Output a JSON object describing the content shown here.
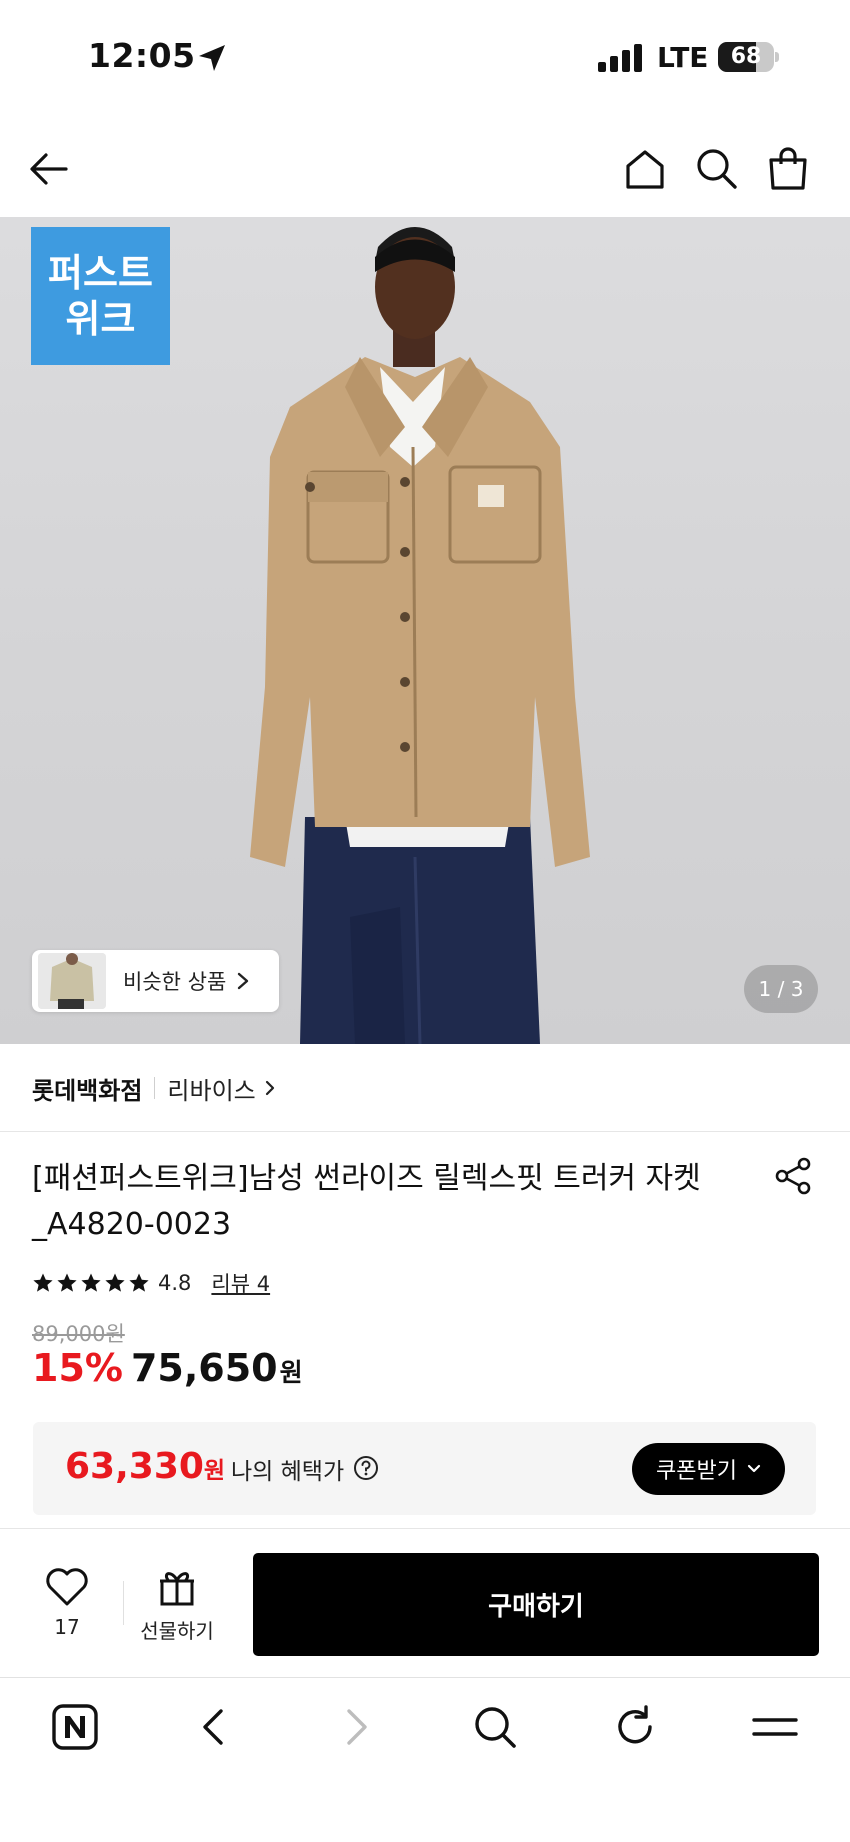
{
  "status_bar": {
    "time": "12:05",
    "network": "LTE",
    "battery": "68",
    "battery_level": 0.68
  },
  "top_nav": {
    "icons": [
      "back-arrow-icon",
      "home-icon",
      "search-icon",
      "shopping-bag-icon"
    ]
  },
  "hero": {
    "badge_text": "퍼스트\n위크",
    "badge_color": "#3e9be0",
    "similar_products_label": "비슷한 상품",
    "page_indicator": "1 / 3"
  },
  "store": {
    "name": "롯데백화점",
    "brand": "리바이스"
  },
  "product": {
    "title": "[패션퍼스트위크]남성 썬라이즈 릴렉스핏 트러커 자켓_A4820-0023",
    "rating_stars": 5,
    "rating": "4.8",
    "review_label": "리뷰 4",
    "original_price": "89,000원",
    "discount": "15%",
    "sale_price": "75,650",
    "sale_unit": "원"
  },
  "benefit": {
    "price": "63,330",
    "unit": "원",
    "label": "나의 혜택가",
    "coupon_button": "쿠폰받기"
  },
  "action_bar": {
    "like_count": "17",
    "gift_label": "선물하기",
    "buy_label": "구매하기"
  },
  "browser_bar": {
    "icons": [
      "naver-n-icon",
      "browser-back-icon",
      "browser-forward-icon",
      "browser-search-icon",
      "reload-icon",
      "menu-icon"
    ]
  },
  "colors": {
    "accent_red": "#e8191f",
    "black": "#000000",
    "badge_blue": "#3e9be0"
  }
}
